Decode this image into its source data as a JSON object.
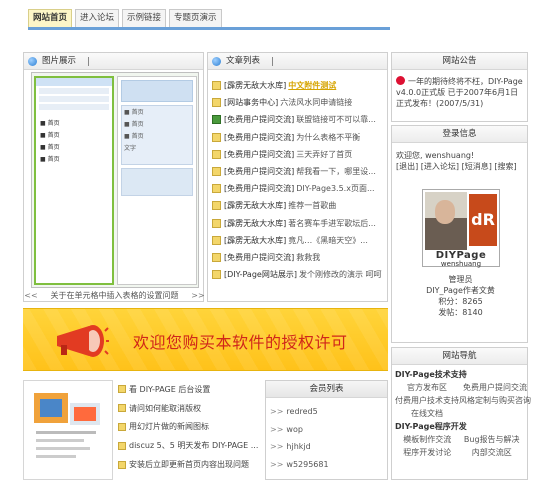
{
  "topnav": {
    "tabs": [
      {
        "label": "网站首页"
      },
      {
        "label": "进入论坛"
      },
      {
        "label": "示例链接"
      },
      {
        "label": "专题页演示"
      }
    ]
  },
  "showcase": {
    "title": "图片展示",
    "caption": "关于在单元格中插入表格的设置问题",
    "prev": "<<",
    "next": ">>"
  },
  "articles": {
    "title": "文章列表",
    "items": [
      {
        "category": "[霹雳无敌大水库]",
        "title": "中文附件测试",
        "hot": true,
        "icon": "doc-icon"
      },
      {
        "category": "[网站事务中心]",
        "title": "六法风水同申请链接",
        "hot": false,
        "icon": "doc-icon"
      },
      {
        "category": "[免费用户提问交流]",
        "title": "联盟链接可不可以靠...",
        "hot": false,
        "icon": "user-icon"
      },
      {
        "category": "[免费用户提问交流]",
        "title": "为什么表格不平衡",
        "hot": false,
        "icon": "doc-icon"
      },
      {
        "category": "[免费用户提问交流]",
        "title": "三天弄好了首页",
        "hot": false,
        "icon": "doc-icon"
      },
      {
        "category": "[免费用户提问交流]",
        "title": "帮我看一下，哪里设...",
        "hot": false,
        "icon": "doc-icon"
      },
      {
        "category": "[免费用户提问交流]",
        "title": "DIY-Page3.5.x页面...",
        "hot": false,
        "icon": "doc-icon"
      },
      {
        "category": "[霹雳无敌大水库]",
        "title": "推荐一首歌曲",
        "hot": false,
        "icon": "doc-icon"
      },
      {
        "category": "[霹雳无敌大水库]",
        "title": "著名赛车手进军歌坛后...",
        "hot": false,
        "icon": "doc-icon"
      },
      {
        "category": "[霹雳无敌大水库]",
        "title": "竟凡…《黑暗天空》...",
        "hot": false,
        "icon": "doc-icon"
      },
      {
        "category": "[免费用户提问交流]",
        "title": "救救我",
        "hot": false,
        "icon": "doc-icon"
      },
      {
        "category": "[DIY-Page网站展示]",
        "title": "发个刚修改的演示 呵呵",
        "hot": false,
        "icon": "doc-icon"
      }
    ]
  },
  "banner": {
    "text": "欢迎您购买本软件的授权许可"
  },
  "news_mini": {
    "items": [
      {
        "label": "看 DIY-PAGE 后台设置"
      },
      {
        "label": "请问如何能取消版权"
      },
      {
        "label": "用幻灯片做的新闻图标"
      },
      {
        "label": "discuz 5、5 明天发布 DIY-PAGE ..."
      },
      {
        "label": "安装后立即更新首页内容出现问题"
      }
    ]
  },
  "members": {
    "title": "会员列表",
    "items": [
      {
        "name": "redred5"
      },
      {
        "name": "wop"
      },
      {
        "name": "hjhkjd"
      },
      {
        "name": "w5295681"
      }
    ]
  },
  "announce": {
    "title": "网站公告",
    "text": "一年的期待终将不枉，DIY-Page v4.0.0正式版 已于2007年6月1日正式发布！(2007/5/31)"
  },
  "login": {
    "title": "登录信息",
    "welcome": "欢迎您, wenshuang!",
    "actions": "[退出] [进入论坛] [短消息] [搜索]",
    "avatar_brand": "DIYPage",
    "avatar_mark": "dR",
    "avatar_user": "wenshuang",
    "role": "管理员",
    "title_line": "DIY_Page作者文黄",
    "points": "积分：8265",
    "posts": "发帖：8140"
  },
  "sitenav": {
    "title": "网站导航",
    "sections": [
      {
        "name": "DIY-Page技术支持",
        "links": [
          "官方发布区",
          "免费用户提问交流",
          "付费用户技术支持",
          "风格定制与购买咨询",
          "在线文档"
        ]
      },
      {
        "name": "DIY-Page程序开发",
        "links": [
          "模板制作交流",
          "Bug报告与解决",
          "程序开发讨论",
          "内部交流区"
        ]
      }
    ]
  },
  "colors": {
    "accent_blue": "#6aa0d8",
    "banner_yellow": "#ffc21a",
    "banner_text": "#d0261a",
    "hot_link": "#d6a400"
  }
}
